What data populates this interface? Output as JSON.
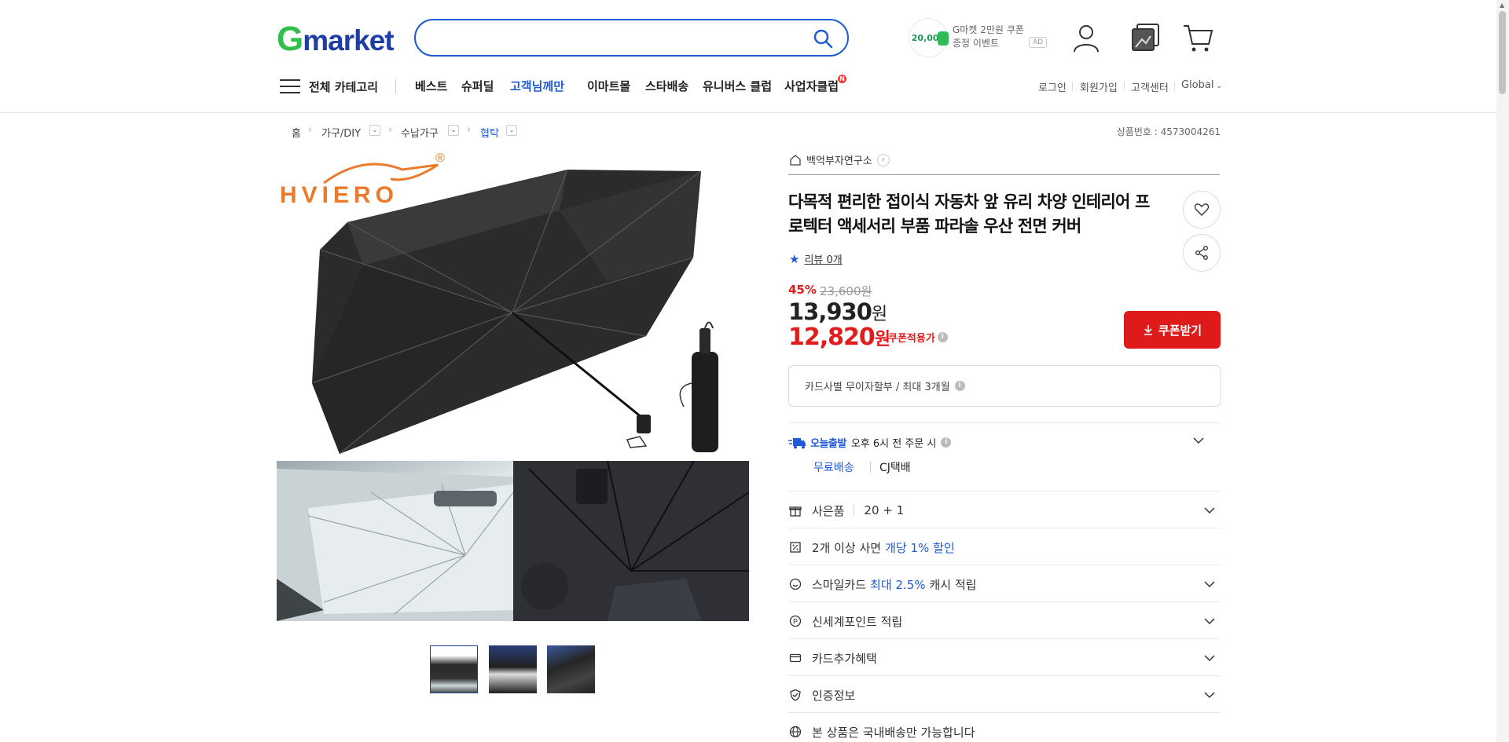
{
  "header": {
    "logo_g": "G",
    "logo_rest": "market",
    "search": {
      "placeholder": ""
    },
    "ad": {
      "coin": "20,000",
      "line1": "G마켓 2만원 쿠폰",
      "line2": "증정 이벤트",
      "tag": "AD"
    }
  },
  "nav": {
    "all_categories": "전체 카테고리",
    "items": [
      "베스트",
      "슈퍼딜",
      "고객님께만",
      "이마트몰",
      "스타배송",
      "유니버스 클럽",
      "사업자클럽"
    ],
    "util_links": [
      "로그인",
      "회원가입",
      "고객센터",
      "Global"
    ]
  },
  "breadcrumb": {
    "items": [
      "홈",
      "가구/DIY",
      "수납가구",
      "협탁"
    ],
    "product_no": "상품번호 : 4573004261"
  },
  "gallery": {
    "brand_logo": "HVIERO"
  },
  "product": {
    "seller": "백억부자연구소",
    "title": "다목적 편리한 접이식 자동차 앞 유리 차양 인테리어 프로텍터 액세서리 부품 파라솔 우산 전면 커버",
    "review": "리뷰 0개",
    "discount_rate": "45%",
    "original_price": "23,600원",
    "price": "13,930",
    "price_unit": "원",
    "coupon_price": "12,820",
    "coupon_unit": "원",
    "coupon_applied": "쿠폰적용가",
    "coupon_button": "쿠폰받기",
    "installment": "카드사별 무이자할부 / 최대 3개월"
  },
  "shipping": {
    "today_tag": "오늘출발",
    "today_text": "오후 6시 전 주문 시",
    "free": "무료배송",
    "company": "CJ택배"
  },
  "options": {
    "gift_label": "사은품",
    "gift_value": "20 + 1",
    "multi_pre": "2개 이상 사면",
    "multi_blue": "개당 1% 할인",
    "smile_pre": "스마일카드",
    "smile_blue": "최대 2.5%",
    "smile_post": "캐시 적립",
    "shinsegae": "신세계포인트 적립",
    "card_benefit": "카드추가혜택",
    "certification": "인증정보",
    "domestic": "본 상품은 국내배송만 가능합니다"
  },
  "colors": {
    "accent_blue": "#1f5bd6",
    "price_red": "#e21c1c",
    "logo_green": "#2fbf4a",
    "logo_blue": "#1e3ea6"
  }
}
